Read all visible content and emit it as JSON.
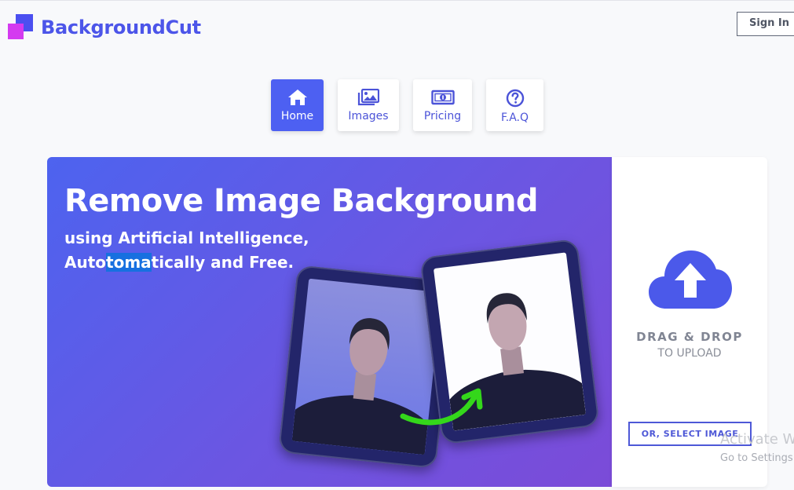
{
  "brand": {
    "name": "BackgroundCut",
    "colors": {
      "primary": "#4c55e9",
      "accent": "#d43af0"
    }
  },
  "header": {
    "signin_label": "Sign In"
  },
  "nav": {
    "items": [
      {
        "label": "Home",
        "icon": "home-icon",
        "active": true
      },
      {
        "label": "Images",
        "icon": "images-icon",
        "active": false
      },
      {
        "label": "Pricing",
        "icon": "money-icon",
        "active": false
      },
      {
        "label": "F.A.Q",
        "icon": "question-icon",
        "active": false
      }
    ]
  },
  "hero": {
    "title": "Remove Image Background",
    "subtitle_line1": "using Artificial Intelligence,",
    "subtitle_line2_highlight_pre": "Auto",
    "subtitle_line2_highlight": "toma",
    "subtitle_line2_rest": "tically and Free."
  },
  "upload": {
    "icon": "cloud-upload-icon",
    "title": "DRAG & DROP",
    "subtitle": "TO UPLOAD",
    "select_label": "OR, SELECT IMAGE"
  },
  "watermark": {
    "line1": "Activate W",
    "line2": "Go to Settings"
  }
}
